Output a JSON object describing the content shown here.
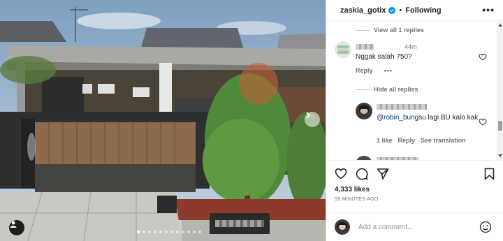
{
  "post": {
    "username": "zaskia_gotix",
    "separator": "•",
    "follow_status": "Following",
    "more_label": "•••"
  },
  "comments": {
    "view_replies": "View all 1 replies",
    "items": [
      {
        "time": "44m",
        "text": "Nggak salah 750?",
        "reply_label": "Reply",
        "options_label": "•••"
      }
    ],
    "hide_replies": "Hide all replies",
    "reply": {
      "mention": "@robin_bungsu",
      "text": " lagi BU kalo kak",
      "likes": "1 like",
      "reply_label": "Reply",
      "translate_label": "See translation"
    }
  },
  "engagement": {
    "likes": "4,333 likes",
    "time_ago": "59 MINUTES AGO"
  },
  "composer": {
    "placeholder": "Add a comment..."
  },
  "carousel": {
    "total_slides": 12,
    "active_index": 0
  },
  "colors": {
    "verified": "#0095f6",
    "mention": "#00376b",
    "muted": "#737373"
  }
}
